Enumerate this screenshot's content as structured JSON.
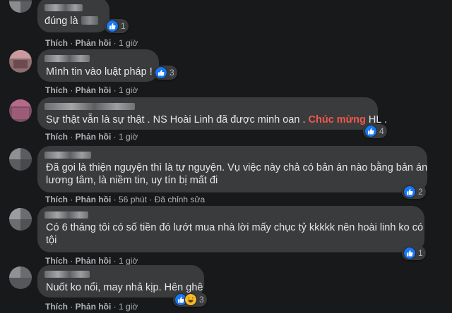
{
  "comments": [
    {
      "text_parts": [
        "đúng là "
      ],
      "reaction_count": "1",
      "actions": {
        "like": "Thích",
        "reply": "Phản hồi",
        "time": "1 giờ"
      }
    },
    {
      "text": "Mình tin vào luật pháp !",
      "reaction_count": "3",
      "actions": {
        "like": "Thích",
        "reply": "Phản hồi",
        "time": "1 giờ"
      }
    },
    {
      "text_before": "Sự thật vẫn là sự thật . NS Hoài Linh đã được minh oan . ",
      "text_highlight": "Chúc mừng",
      "text_after": " HL .",
      "reaction_count": "4",
      "actions": {
        "like": "Thích",
        "reply": "Phản hồi",
        "time": "1 giờ"
      }
    },
    {
      "line1": "Đã gọi là thiện nguyện thì là tự nguyện. Vụ việc này chả có bản án nào bằng bản án",
      "line2": "lương tâm, là niềm tin, uy tín bị mất đi",
      "reaction_count": "2",
      "actions": {
        "like": "Thích",
        "reply": "Phản hồi",
        "time": "56 phút",
        "edited": "Đã chỉnh sửa"
      }
    },
    {
      "line1": "Có 6 tháng tôi có số tiền đó lướt mua nhà lời mấy chục tỷ kkkkk nên hoài linh ko có",
      "line2": "tội",
      "reaction_count": "1",
      "actions": {
        "like": "Thích",
        "reply": "Phản hồi",
        "time": "1 giờ"
      }
    },
    {
      "text": "Nuốt ko nổi, may nhả kịp. Hên ghê",
      "reaction_count": "3",
      "actions": {
        "like": "Thích",
        "reply": "Phản hồi",
        "time": "1 giờ"
      }
    }
  ],
  "colors": {
    "background": "#18191a",
    "bubble": "#3a3b3c",
    "text": "#e4e6eb",
    "secondary": "#b0b3b8",
    "highlight": "#f3574a",
    "like": "#1877f2",
    "haha": "#f7b928"
  },
  "icons": {
    "like": "like-thumb-icon",
    "haha": "haha-emoji-icon"
  }
}
